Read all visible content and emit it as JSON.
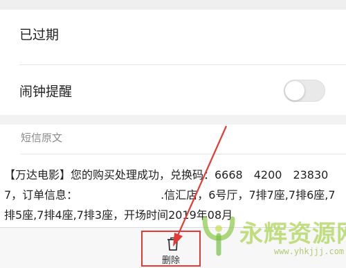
{
  "settings": {
    "expired_label": "已过期",
    "alarm_label": "闹钟提醒",
    "alarm_enabled": false
  },
  "sms": {
    "section_title": "短信原文",
    "body": "【万达电影】您的购买处理成功，兑换码：6668　4200　238307，订单信息：　　　　　　　　.信汇店，6号厅，7排7座,7排6座,7排5座,7排4座,7排3座，开场时间2019年08月"
  },
  "toolbar": {
    "delete_label": "删除",
    "highlight_color": "#e53935"
  },
  "watermark": {
    "title": "永辉资源网",
    "url": "www.yhkjjj.com"
  }
}
